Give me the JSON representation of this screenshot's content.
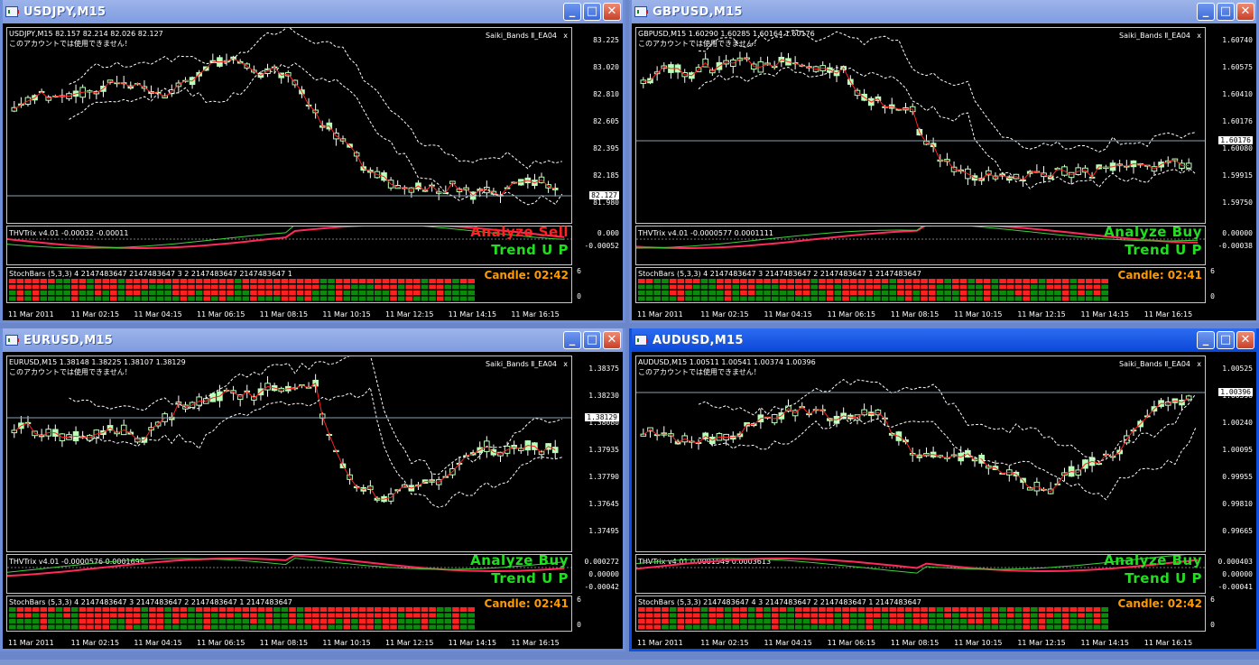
{
  "windows": [
    {
      "id": "usdjpy",
      "title": "USDJPY,M15",
      "active": false,
      "info": "USDJPY,M15  82.157 82.214 82.026 82.127",
      "note": "このアカウントでは使用できません！",
      "ea": "Saiki_Bands Ⅱ_EA04",
      "close_x": "x",
      "prices": [
        "83.225",
        "83.020",
        "82.810",
        "82.605",
        "82.395",
        "82.185",
        "81.980"
      ],
      "current_price": "82.127",
      "trix_label": "THVTrix v4.01 -0.00032 -0.00011",
      "trix_scale": [
        "0.000",
        "-0.00052"
      ],
      "analyze": "Analyze Sell",
      "analyze_color": "#ff2222",
      "trend": "Trend U P",
      "stoch_label": "StochBars (5,3,3) 4 2147483647 2147483647 3 2 2147483647 2147483647 1",
      "stoch_scale": [
        "6",
        "0"
      ],
      "candle": "Candle:  02:42",
      "times": [
        "11 Mar 2011",
        "11 Mar 02:15",
        "11 Mar 04:15",
        "11 Mar 06:15",
        "11 Mar 08:15",
        "11 Mar 10:15",
        "11 Mar 12:15",
        "11 Mar 14:15",
        "11 Mar 16:15"
      ]
    },
    {
      "id": "gbpusd",
      "title": "GBPUSD,M15",
      "active": false,
      "info": "GBPUSD,M15  1.60290 1.60285 1.60164 1.60176",
      "note": "このアカウントでは使用できません！",
      "ea": "Saiki_Bands Ⅱ_EA04",
      "close_x": "x",
      "prices": [
        "1.60740",
        "1.60575",
        "1.60410",
        "1.60176",
        "1.60080",
        "1.59915",
        "1.59750"
      ],
      "current_price": "1.60176",
      "trix_label": "THVTrix v4.01 -0.0000577 0.0001111",
      "trix_scale": [
        "0.00000",
        "-0.00038"
      ],
      "analyze": "Analyze Buy",
      "analyze_color": "#22dd22",
      "trend": "Trend U P",
      "stoch_label": "StochBars (5,3,3) 4 2147483647 3 2147483647 2 2147483647 1 2147483647",
      "stoch_scale": [
        "6",
        "0"
      ],
      "candle": "Candle:  02:41",
      "times": [
        "11 Mar 2011",
        "11 Mar 02:15",
        "11 Mar 04:15",
        "11 Mar 06:15",
        "11 Mar 08:15",
        "11 Mar 10:15",
        "11 Mar 12:15",
        "11 Mar 14:15",
        "11 Mar 16:15"
      ]
    },
    {
      "id": "eurusd",
      "title": "EURUSD,M15",
      "active": false,
      "info": "EURUSD,M15  1.38148 1.38225 1.38107 1.38129",
      "note": "このアカウントでは使用できません！",
      "ea": "Saiki_Bands Ⅱ_EA04",
      "close_x": "x",
      "prices": [
        "1.38375",
        "1.38230",
        "1.38080",
        "1.37935",
        "1.37790",
        "1.37645",
        "1.37495"
      ],
      "current_price": "1.38129",
      "trix_label": "THVTrix v4.01 -0.0000576 0.0001699",
      "trix_scale": [
        "0.000272",
        "0.00000",
        "-0.00042"
      ],
      "analyze": "Analyze Buy",
      "analyze_color": "#22dd22",
      "trend": "Trend U P",
      "stoch_label": "StochBars (5,3,3) 4 2147483647 3 2147483647 2 2147483647 1 2147483647",
      "stoch_scale": [
        "6",
        "0"
      ],
      "candle": "Candle:  02:41",
      "times": [
        "11 Mar 2011",
        "11 Mar 02:15",
        "11 Mar 04:15",
        "11 Mar 06:15",
        "11 Mar 08:15",
        "11 Mar 10:15",
        "11 Mar 12:15",
        "11 Mar 14:15",
        "11 Mar 16:15"
      ]
    },
    {
      "id": "audusd",
      "title": "AUDUSD,M15",
      "active": true,
      "info": "AUDUSD,M15  1.00511 1.00541 1.00374 1.00396",
      "note": "このアカウントでは使用できません！",
      "ea": "Saiki_Bands Ⅱ_EA04",
      "close_x": "x",
      "prices": [
        "1.00525",
        "1.00396",
        "1.00240",
        "1.00095",
        "0.99955",
        "0.99810",
        "0.99665"
      ],
      "current_price": "1.00396",
      "trix_label": "THVTrix v4.01 0.0001549 0.0003613",
      "trix_scale": [
        "0.000403",
        "0.00000",
        "-0.00041"
      ],
      "analyze": "Analyze Buy",
      "analyze_color": "#22dd22",
      "trend": "Trend U P",
      "stoch_label": "StochBars (5,3,3) 2147483647 4 3 2147483647 2 2147483647 1 2147483647",
      "stoch_scale": [
        "6",
        "0"
      ],
      "candle": "Candle:  02:42",
      "times": [
        "11 Mar 2011",
        "11 Mar 02:15",
        "11 Mar 04:15",
        "11 Mar 06:15",
        "11 Mar 08:15",
        "11 Mar 10:15",
        "11 Mar 12:15",
        "11 Mar 14:15",
        "11 Mar 16:15"
      ]
    }
  ],
  "colors": {
    "bull": "#b8ffb8",
    "bear": "#ffffff",
    "ma": "#ff2020",
    "cloud": "#ffffff",
    "trix_a": "#ff2a5a",
    "trix_b": "#3ed23e",
    "stoch_red": "#ff2020",
    "stoch_green": "#0c8a0c",
    "candle": "#ff9900"
  }
}
